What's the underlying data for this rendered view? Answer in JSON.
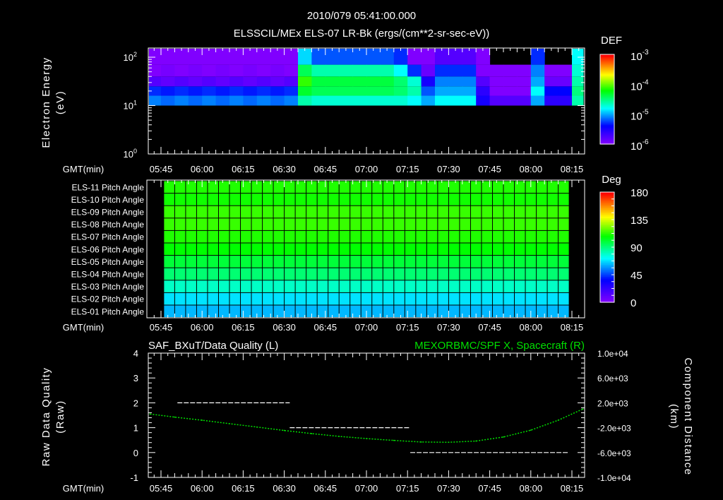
{
  "header": {
    "timestamp": "2010/079 05:41:00.000",
    "title": "ELSSCIL/MEx ELS-07 LR-Bk  (ergs/(cm**2-sr-sec-eV))"
  },
  "colors": {
    "background": "#000000",
    "axes": "#ffffff",
    "right_series": "#00e000"
  },
  "chart_data": [
    {
      "type": "heatmap",
      "name": "energy-spectrogram",
      "ylabel": "Electron Energy",
      "ylabel_unit": "(eV)",
      "yscale": "log",
      "ytick_labels": [
        {
          "base": "10",
          "exp": "0"
        },
        {
          "base": "10",
          "exp": "1"
        },
        {
          "base": "10",
          "exp": "2"
        }
      ],
      "x_axis_label": "GMT(min)",
      "xtick_labels": [
        "05:45",
        "06:00",
        "06:15",
        "06:30",
        "06:45",
        "07:00",
        "07:15",
        "07:30",
        "07:45",
        "08:00",
        "08:15"
      ],
      "colorbar": {
        "label": "DEF",
        "scale": "log",
        "range": [
          1e-06,
          0.001
        ],
        "tick_labels": [
          {
            "base": "10",
            "exp": "-3"
          },
          {
            "base": "10",
            "exp": "-4"
          },
          {
            "base": "10",
            "exp": "-5"
          },
          {
            "base": "10",
            "exp": "-6"
          }
        ]
      },
      "energy_bins_eV": [
        [
          10,
          16
        ],
        [
          16,
          25
        ],
        [
          25,
          40
        ],
        [
          40,
          70
        ],
        [
          70,
          155
        ]
      ],
      "columns": [
        {
          "t": "05:40",
          "def": [
            8e-06,
            5e-06,
            1.6e-06,
            1e-06,
            1e-06
          ]
        },
        {
          "t": "05:45",
          "def": [
            7e-06,
            4.5e-06,
            1.4e-06,
            1.1e-06,
            9e-07
          ]
        },
        {
          "t": "05:50",
          "def": [
            8e-06,
            5e-06,
            1.6e-06,
            1e-06,
            1e-06
          ]
        },
        {
          "t": "05:55",
          "def": [
            7e-06,
            4.5e-06,
            1.4e-06,
            1.1e-06,
            9e-07
          ]
        },
        {
          "t": "06:00",
          "def": [
            8e-06,
            5e-06,
            1.6e-06,
            1e-06,
            1e-06
          ]
        },
        {
          "t": "06:05",
          "def": [
            7e-06,
            4.5e-06,
            1.4e-06,
            1.1e-06,
            9e-07
          ]
        },
        {
          "t": "06:10",
          "def": [
            8e-06,
            5e-06,
            1.6e-06,
            1e-06,
            1e-06
          ]
        },
        {
          "t": "06:15",
          "def": [
            7e-06,
            4.5e-06,
            1.4e-06,
            1.1e-06,
            9e-07
          ]
        },
        {
          "t": "06:20",
          "def": [
            8e-06,
            5e-06,
            1.6e-06,
            1e-06,
            1e-06
          ]
        },
        {
          "t": "06:25",
          "def": [
            7e-06,
            4.5e-06,
            1.4e-06,
            1.1e-06,
            9e-07
          ]
        },
        {
          "t": "06:30",
          "def": [
            8e-06,
            5e-06,
            1.6e-06,
            1e-06,
            1e-06
          ]
        },
        {
          "t": "06:35",
          "def": [
            2.5e-05,
            5e-05,
            8e-05,
            4e-05,
            1.3e-05
          ]
        },
        {
          "t": "06:40",
          "def": [
            2e-05,
            4e-05,
            4.5e-05,
            2.5e-05,
            6.3e-06
          ]
        },
        {
          "t": "06:45",
          "def": [
            2e-05,
            4e-05,
            4.5e-05,
            2.5e-05,
            6.3e-06
          ]
        },
        {
          "t": "06:50",
          "def": [
            2e-05,
            4e-05,
            4.5e-05,
            2.5e-05,
            6.3e-06
          ]
        },
        {
          "t": "06:55",
          "def": [
            2e-05,
            4e-05,
            4.5e-05,
            2.5e-05,
            6.3e-06
          ]
        },
        {
          "t": "07:00",
          "def": [
            2e-05,
            4e-05,
            4.5e-05,
            2.5e-05,
            6.3e-06
          ]
        },
        {
          "t": "07:05",
          "def": [
            2e-05,
            4e-05,
            4.5e-05,
            2.5e-05,
            6.3e-06
          ]
        },
        {
          "t": "07:10",
          "def": [
            2e-05,
            3.5e-05,
            3.5e-05,
            1.6e-05,
            5e-06
          ]
        },
        {
          "t": "07:15",
          "def": [
            1.6e-05,
            2.5e-05,
            2e-05,
            5e-06,
            8e-07
          ]
        },
        {
          "t": "07:20",
          "def": [
            1e-05,
            6.3e-06,
            3.2e-06,
            1.3e-06,
            5e-07
          ]
        },
        {
          "t": "07:25",
          "def": [
            1.6e-05,
            1e-05,
            8e-06,
            5e-06,
            1.6e-06
          ]
        },
        {
          "t": "07:30",
          "def": [
            1.6e-05,
            1e-05,
            8e-06,
            5e-06,
            1.6e-06
          ]
        },
        {
          "t": "07:35",
          "def": [
            1.6e-05,
            1e-05,
            8e-06,
            5e-06,
            1.6e-06
          ]
        },
        {
          "t": "07:40",
          "def": [
            3.2e-06,
            2.5e-06,
            1.6e-06,
            1e-06,
            5e-07
          ]
        },
        {
          "t": "07:45",
          "def": [
            1.6e-06,
            1e-06,
            6.3e-07,
            5e-07,
            null
          ]
        },
        {
          "t": "07:50",
          "def": [
            1.6e-06,
            1e-06,
            6.3e-07,
            5e-07,
            null
          ]
        },
        {
          "t": "07:55",
          "def": [
            1.6e-06,
            1e-06,
            6.3e-07,
            5e-07,
            null
          ]
        },
        {
          "t": "08:00",
          "def": [
            1e-05,
            1.6e-05,
            1e-05,
            8e-06,
            5e-06
          ]
        },
        {
          "t": "08:05",
          "def": [
            2.5e-06,
            4e-06,
            1.3e-06,
            6.3e-07,
            null
          ]
        },
        {
          "t": "08:10",
          "def": [
            2.5e-06,
            4e-06,
            1.3e-06,
            6.3e-07,
            null
          ]
        },
        {
          "t": "08:15",
          "def": [
            2.5e-05,
            3.2e-05,
            2.5e-05,
            2e-05,
            1.6e-05
          ]
        }
      ]
    },
    {
      "type": "heatmap",
      "name": "pitch-angle",
      "x_axis_label": "GMT(min)",
      "xtick_labels": [
        "05:45",
        "06:00",
        "06:15",
        "06:30",
        "06:45",
        "07:00",
        "07:15",
        "07:30",
        "07:45",
        "08:00",
        "08:15"
      ],
      "colorbar": {
        "label": "Deg",
        "range": [
          0,
          180
        ],
        "tick_labels": [
          "180",
          "135",
          "90",
          "45",
          "0"
        ]
      },
      "start": "05:46",
      "end": "08:14",
      "sample_interval_min": 4,
      "rows": [
        {
          "label": "ELS-11 Pitch Angle",
          "value": 112
        },
        {
          "label": "ELS-10 Pitch Angle",
          "value": 110
        },
        {
          "label": "ELS-09 Pitch Angle",
          "value": 115
        },
        {
          "label": "ELS-08 Pitch Angle",
          "value": 115
        },
        {
          "label": "ELS-07 Pitch Angle",
          "value": 112
        },
        {
          "label": "ELS-06 Pitch Angle",
          "value": 108
        },
        {
          "label": "ELS-05 Pitch Angle",
          "value": 100
        },
        {
          "label": "ELS-04 Pitch Angle",
          "value": 92
        },
        {
          "label": "ELS-03 Pitch Angle",
          "value": 80
        },
        {
          "label": "ELS-02 Pitch Angle",
          "value": 68
        },
        {
          "label": "ELS-01 Pitch Angle",
          "value": 62
        }
      ]
    },
    {
      "type": "line",
      "name": "quality-and-position",
      "left_title": "SAF_BXuT/Data Quality (L)",
      "right_title": "MEXORBMC/SPF X, Spacecraft (R)",
      "ylabel_left": "Raw Data Quality",
      "ylabel_left_unit": "(Raw)",
      "ylabel_right": "Component Distance",
      "ylabel_right_unit": "(km)",
      "x_axis_label": "GMT(min)",
      "xtick_labels": [
        "05:45",
        "06:00",
        "06:15",
        "06:30",
        "06:45",
        "07:00",
        "07:15",
        "07:30",
        "07:45",
        "08:00",
        "08:15"
      ],
      "ylim_left": [
        -1,
        4
      ],
      "ytick_labels_left": [
        "4",
        "3",
        "2",
        "1",
        "0",
        "-1"
      ],
      "ylim_right": [
        -10000,
        10000
      ],
      "ytick_labels_right": [
        "1.0e+04",
        "6.0e+03",
        "2.0e+03",
        "-2.0e+03",
        "-6.0e+03",
        "-1.0e+04"
      ],
      "series": [
        {
          "axis": "left",
          "style": "dashed",
          "segments": [
            {
              "start": "05:51",
              "end": "06:32",
              "value": 2
            },
            {
              "start": "06:32",
              "end": "07:16",
              "value": 1
            },
            {
              "start": "07:16",
              "end": "08:14",
              "value": 0
            }
          ]
        },
        {
          "axis": "right",
          "style": "dotted",
          "x": [
            "05:41",
            "05:50",
            "06:00",
            "06:10",
            "06:20",
            "06:30",
            "06:40",
            "06:50",
            "07:00",
            "07:10",
            "07:20",
            "07:30",
            "07:40",
            "07:50",
            "08:00",
            "08:10",
            "08:19"
          ],
          "y": [
            200,
            -300,
            -800,
            -1350,
            -1900,
            -2450,
            -2950,
            -3400,
            -3750,
            -4050,
            -4300,
            -4350,
            -4150,
            -3500,
            -2400,
            -800,
            1000
          ]
        }
      ]
    }
  ]
}
